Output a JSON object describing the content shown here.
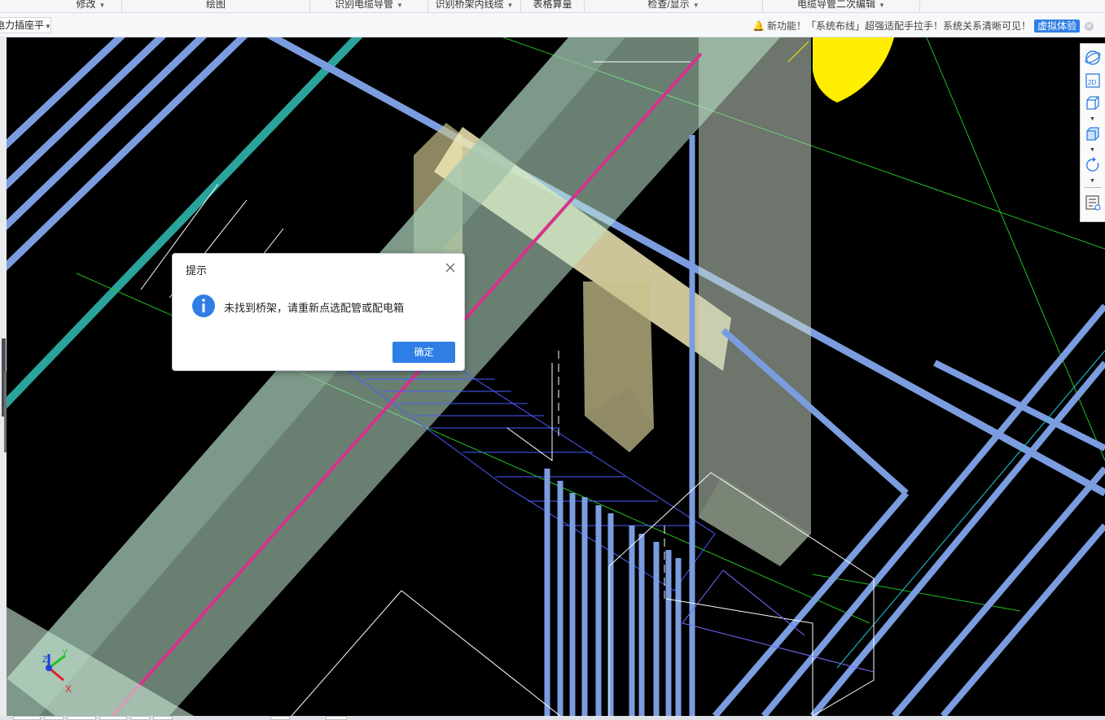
{
  "ribbon": {
    "groups": [
      {
        "label": "修改",
        "caret": true
      },
      {
        "label": "绘图",
        "caret": false
      },
      {
        "label": "识别电缆导管",
        "caret": true
      },
      {
        "label": "识别桥架内线缆",
        "caret": true
      },
      {
        "label": "表格算量",
        "caret": false
      },
      {
        "label": "检查/显示",
        "caret": true
      },
      {
        "label": "电缆导管二次编辑",
        "caret": true
      }
    ]
  },
  "toolbar2": {
    "combo_value": "电力插座平",
    "notice": {
      "text": "新功能！「系统布线」超强适配手拉手！系统关系清晰可见！",
      "button_label": "虚拟体验"
    }
  },
  "right_toolbar": {
    "icons": [
      "orbit-icon",
      "view-2d-icon",
      "view-3d-cube-icon",
      "view-box-icon",
      "rotate-icon",
      "layer-display-icon"
    ],
    "text_2d": "2D"
  },
  "axis_gizmo": {
    "x_label": "X",
    "y_label": "Y",
    "z_label": "Z"
  },
  "dialog": {
    "title": "提示",
    "message": "未找到桥架，请重新点选配管或配电箱",
    "ok_label": "确定"
  },
  "colors": {
    "accent": "#2f7ee6",
    "viewport_bg": "#000000",
    "pipe_blue": "#7b9de0",
    "tray_green": "#bfe8cf",
    "magenta_line": "#d6338a",
    "box_khaki": "#c8c08c",
    "yellow": "#ffee00",
    "teal": "#2aa39a"
  }
}
